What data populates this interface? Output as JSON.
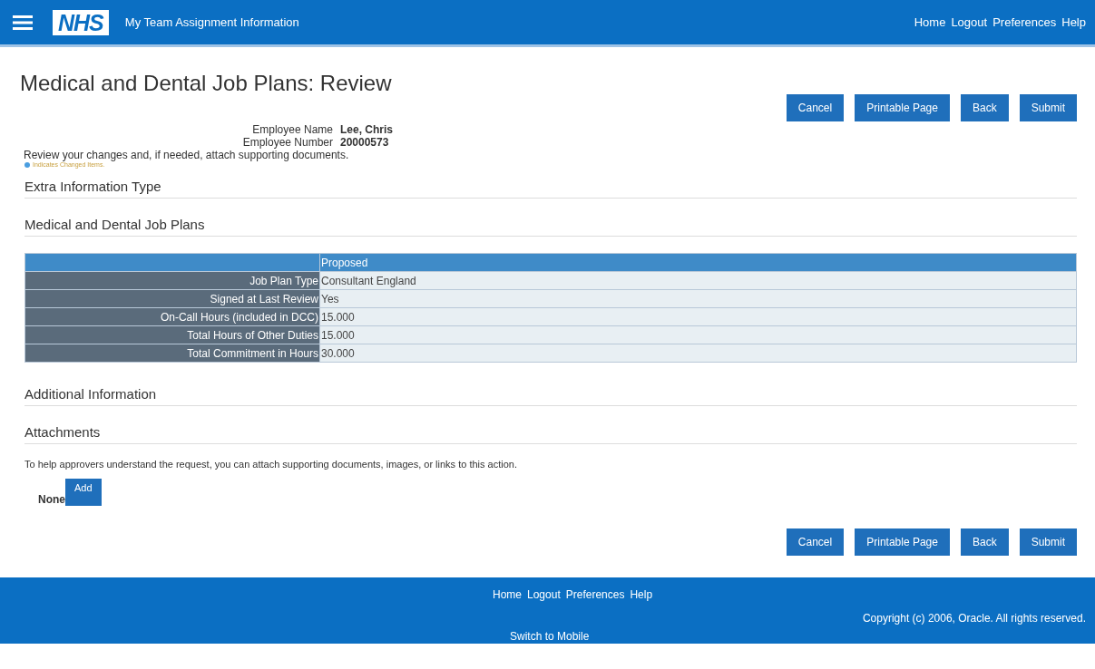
{
  "header": {
    "logo": "NHS",
    "title": "My Team Assignment Information",
    "links": [
      "Home",
      "Logout",
      "Preferences",
      "Help"
    ]
  },
  "page_title": "Medical and Dental Job Plans: Review",
  "top_buttons": [
    "Cancel",
    "Printable Page",
    "Back",
    "Submit"
  ],
  "employee": [
    {
      "label": "Employee Name",
      "value": "Lee, Chris"
    },
    {
      "label": "Employee Number",
      "value": "20000573"
    }
  ],
  "instruction": "Review your changes and, if needed, attach supporting documents.",
  "legend": "Indicates Changed Items.",
  "sections": [
    {
      "title": "Extra Information Type"
    },
    {
      "title": "Medical and Dental Job Plans"
    }
  ],
  "table": {
    "column_header": "Proposed",
    "rows": [
      {
        "label": "Job Plan Type",
        "value": "Consultant England"
      },
      {
        "label": "Signed at Last Review",
        "value": "Yes"
      },
      {
        "label": "On-Call Hours (included in DCC)",
        "value": "15.000"
      },
      {
        "label": "Total Hours of Other Duties",
        "value": "15.000"
      },
      {
        "label": "Total Commitment in Hours",
        "value": "30.000"
      }
    ]
  },
  "additional_information": {
    "title": "Additional Information"
  },
  "attachments": {
    "title": "Attachments",
    "text": "To help approvers understand the request, you can attach supporting documents, images, or links to this action.",
    "status": "None",
    "button": "Add"
  },
  "bottom_buttons": [
    "Cancel",
    "Printable Page",
    "Back",
    "Submit"
  ],
  "footer": {
    "links": [
      "Home",
      "Logout",
      "Preferences",
      "Help"
    ],
    "copyright": "Copyright (c) 2006, Oracle. All rights reserved.",
    "mobile_link": "Switch to Mobile"
  }
}
